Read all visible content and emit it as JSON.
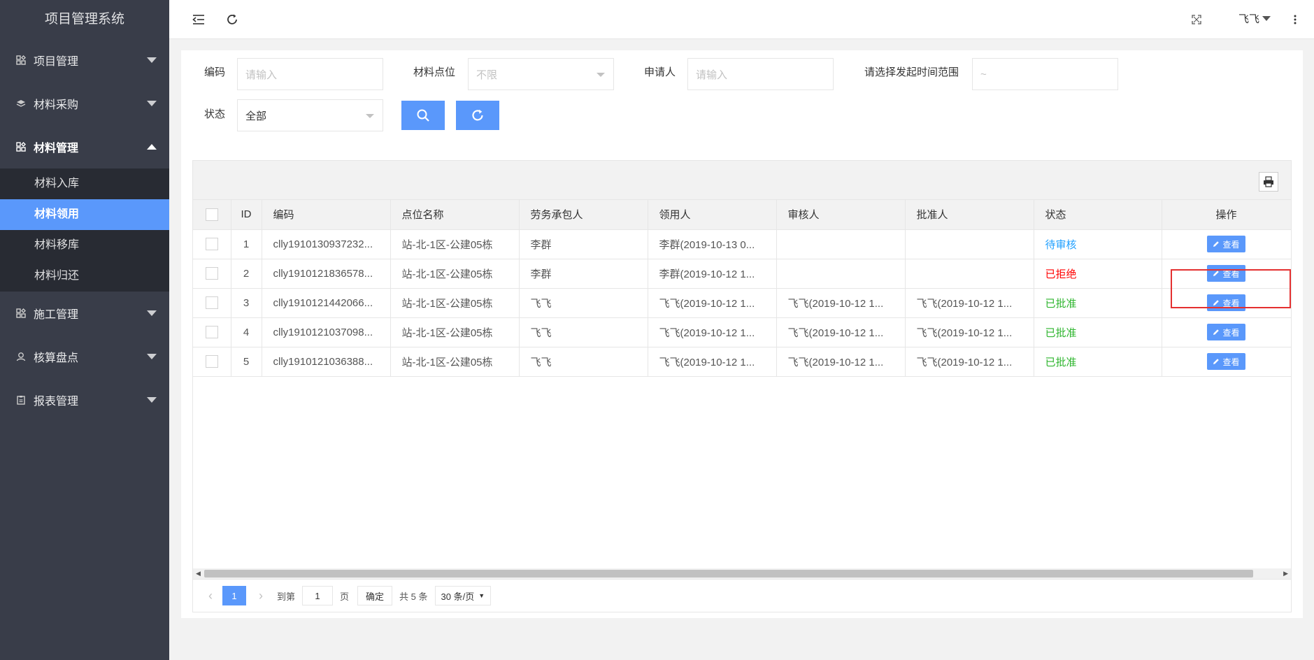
{
  "app": {
    "title": "项目管理系统"
  },
  "sidebar": {
    "items": [
      {
        "label": "项目管理",
        "icon": "dashboard-icon"
      },
      {
        "label": "材料采购",
        "icon": "layers-icon"
      },
      {
        "label": "材料管理",
        "icon": "dashboard-icon",
        "open": true
      },
      {
        "label": "施工管理",
        "icon": "dashboard-icon"
      },
      {
        "label": "核算盘点",
        "icon": "user-icon"
      },
      {
        "label": "报表管理",
        "icon": "clipboard-icon"
      }
    ],
    "submenu": [
      "材料入库",
      "材料领用",
      "材料移库",
      "材料归还"
    ],
    "active_sub": "材料领用"
  },
  "header": {
    "user_name": "飞飞"
  },
  "filters": {
    "code_label": "编码",
    "code_placeholder": "请输入",
    "location_label": "材料点位",
    "location_value": "不限",
    "applicant_label": "申请人",
    "applicant_placeholder": "请输入",
    "time_label": "请选择发起时间范围",
    "time_placeholder": "~",
    "status_label": "状态",
    "status_value": "全部"
  },
  "table": {
    "headers": [
      "ID",
      "编码",
      "点位名称",
      "劳务承包人",
      "领用人",
      "审核人",
      "批准人",
      "状态",
      "操作"
    ],
    "rows": [
      {
        "id": "1",
        "code": "clly1910130937232...",
        "location": "站-北-1区-公建05栋",
        "contractor": "李群",
        "receiver": "李群(2019-10-13 0...",
        "reviewer": "",
        "approver": "",
        "status": "待审核",
        "status_type": "wait",
        "action": "查看"
      },
      {
        "id": "2",
        "code": "clly1910121836578...",
        "location": "站-北-1区-公建05栋",
        "contractor": "李群",
        "receiver": "李群(2019-10-12 1...",
        "reviewer": "",
        "approver": "",
        "status": "已拒绝",
        "status_type": "rej",
        "action": "查看"
      },
      {
        "id": "3",
        "code": "clly1910121442066...",
        "location": "站-北-1区-公建05栋",
        "contractor": "飞飞",
        "receiver": "飞飞(2019-10-12 1...",
        "reviewer": "飞飞(2019-10-12 1...",
        "approver": "飞飞(2019-10-12 1...",
        "status": "已批准",
        "status_type": "ok",
        "action": "查看"
      },
      {
        "id": "4",
        "code": "clly1910121037098...",
        "location": "站-北-1区-公建05栋",
        "contractor": "飞飞",
        "receiver": "飞飞(2019-10-12 1...",
        "reviewer": "飞飞(2019-10-12 1...",
        "approver": "飞飞(2019-10-12 1...",
        "status": "已批准",
        "status_type": "ok",
        "action": "查看"
      },
      {
        "id": "5",
        "code": "clly1910121036388...",
        "location": "站-北-1区-公建05栋",
        "contractor": "飞飞",
        "receiver": "飞飞(2019-10-12 1...",
        "reviewer": "飞飞(2019-10-12 1...",
        "approver": "飞飞(2019-10-12 1...",
        "status": "已批准",
        "status_type": "ok",
        "action": "查看"
      }
    ]
  },
  "pagination": {
    "current": "1",
    "goto_label": "到第",
    "goto_value": "1",
    "page_unit": "页",
    "confirm": "确定",
    "total": "共 5 条",
    "page_size": "30 条/页"
  },
  "colors": {
    "sidebar_bg": "#393d49",
    "accent": "#5a98fb",
    "wait": "#1e9fff",
    "rejected": "#ff0000",
    "approved": "#2db52d"
  }
}
